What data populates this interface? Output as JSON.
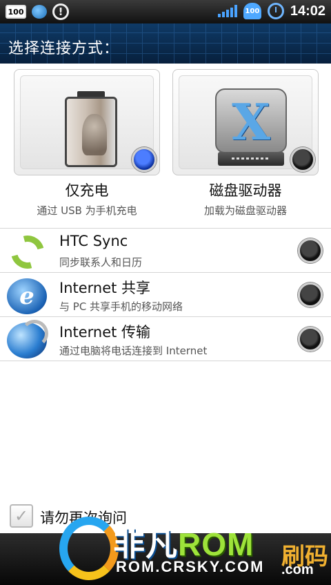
{
  "status_bar": {
    "battery_badge": "100",
    "android_badge": "100",
    "time": "14:02",
    "alert_glyph": "!"
  },
  "header": {
    "title": "选择连接方式："
  },
  "options": [
    {
      "label": "仅充电",
      "sub": "通过 USB 为手机充电",
      "selected": true,
      "icon": "battery-icon"
    },
    {
      "label": "磁盘驱动器",
      "sub": "加载为磁盘驱动器",
      "selected": false,
      "icon": "disk-drive-icon",
      "glyph": "X"
    }
  ],
  "list": [
    {
      "title": "HTC Sync",
      "sub": "同步联系人和日历",
      "selected": false,
      "icon": "sync-icon"
    },
    {
      "title": "Internet 共享",
      "sub": "与 PC 共享手机的移动网络",
      "selected": false,
      "icon": "internet-explorer-icon",
      "glyph": "e"
    },
    {
      "title": "Internet 传输",
      "sub": "通过电脑将电话连接到 Internet",
      "selected": false,
      "icon": "globe-icon"
    }
  ],
  "footer": {
    "checkbox_label": "请勿再次询问",
    "checkbox_checked": true,
    "check_glyph": "✓"
  },
  "watermark": {
    "brand_left": "非凡",
    "brand_right": "ROM",
    "side_text": "刷码",
    "url": "ROM.CRSKY.COM",
    "side_suffix": ".com"
  },
  "colors": {
    "title_bar": "#0f3a66",
    "radio_on": "#4c7dff",
    "radio_off": "#111111",
    "sync_green": "#8fc63f"
  }
}
